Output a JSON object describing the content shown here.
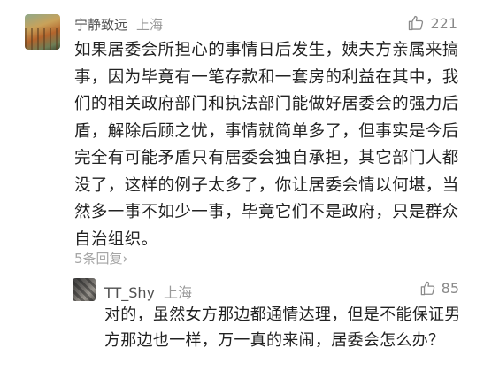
{
  "comment": {
    "username": "宁静致远",
    "location": "上海",
    "likes": "221",
    "text": "如果居委会所担心的事情日后发生，姨夫方亲属来搞事，因为毕竟有一笔存款和一套房的利益在其中，我们的相关政府部门和执法部门能做好居委会的强力后盾，解除后顾之忧，事情就简单多了，但事实是今后完全有可能矛盾只有居委会独自承担，其它部门人都没了，这样的例子太多了，你让居委会情以何堪，当然多一事不如少一事，毕竟它们不是政府，只是群众自治组织。",
    "reply_count_label": "5条回复",
    "avatar_icon": "autumn-trees-avatar",
    "like_icon": "thumbs-up-icon"
  },
  "reply": {
    "username": "TT_Shy",
    "location": "上海",
    "likes": "85",
    "text": "对的，虽然女方那边都通情达理，但是不能保证男方那边也一样，万一真的来闹，居委会怎么办？",
    "avatar_icon": "cat-avatar",
    "like_icon": "thumbs-up-icon"
  },
  "colors": {
    "username": "#505050",
    "location": "#9a9a9a",
    "body_text": "#222222",
    "muted": "#a6a6a6"
  }
}
